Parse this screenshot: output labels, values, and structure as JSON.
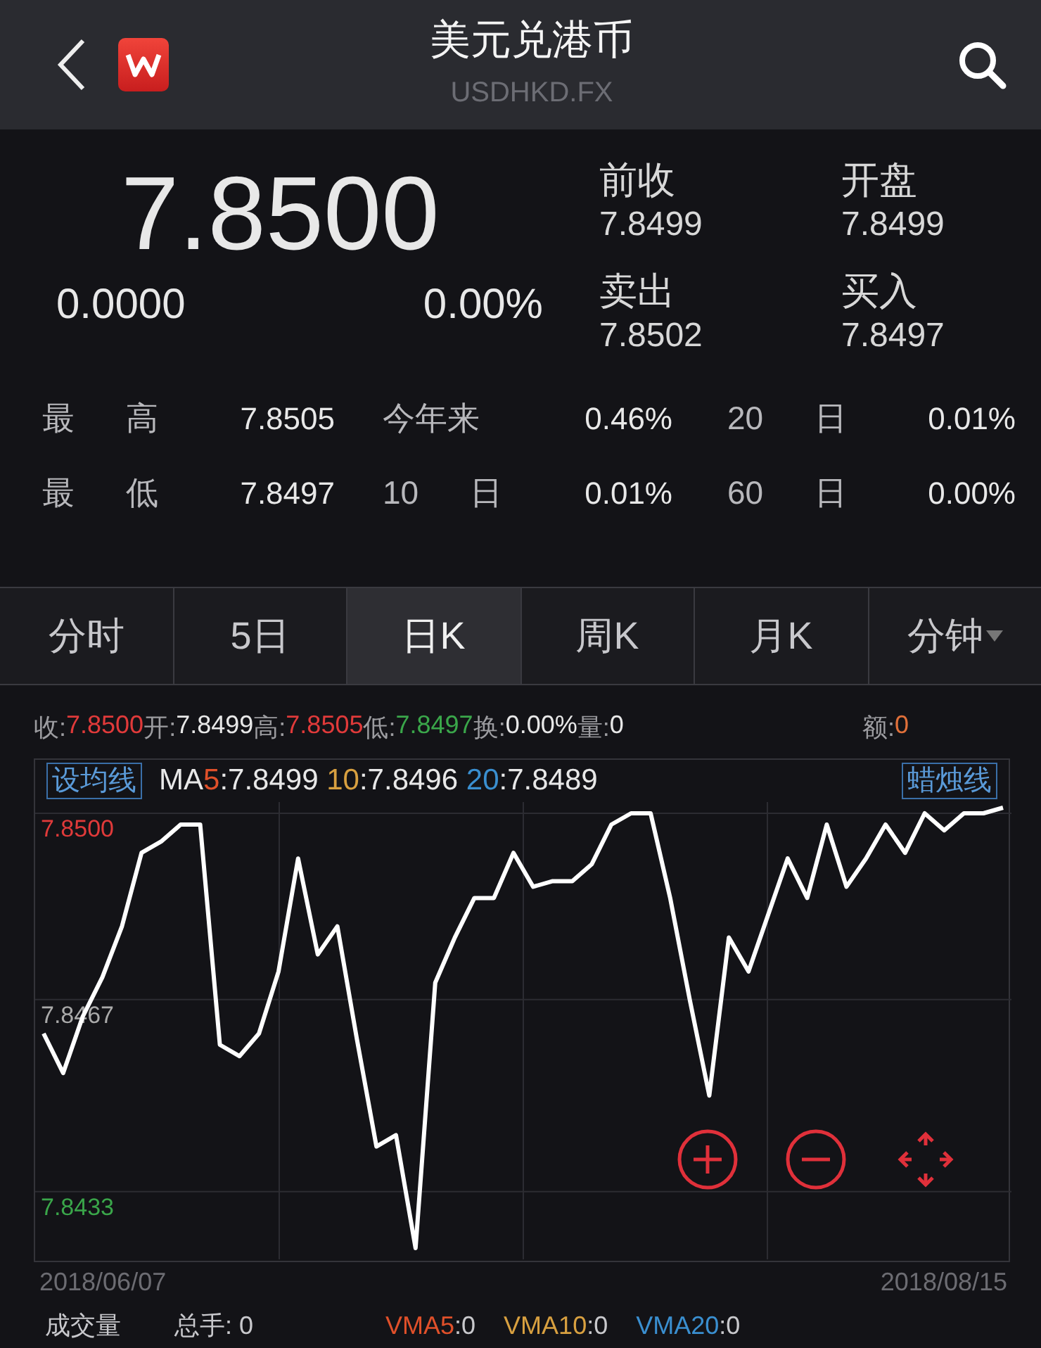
{
  "header": {
    "title": "美元兑港币",
    "subtitle": "USDHKD.FX"
  },
  "quote": {
    "price": "7.8500",
    "change": "0.0000",
    "change_pct": "0.00%",
    "fields": [
      {
        "label": "前收",
        "value": "7.8499"
      },
      {
        "label": "开盘",
        "value": "7.8499"
      },
      {
        "label": "卖出",
        "value": "7.8502"
      },
      {
        "label": "买入",
        "value": "7.8497"
      }
    ]
  },
  "stats": [
    [
      {
        "label": "最 高",
        "value": "7.8505"
      },
      {
        "label": "今年来",
        "value": "0.46%"
      },
      {
        "label": "20 日",
        "value": "0.01%"
      }
    ],
    [
      {
        "label": "最 低",
        "value": "7.8497"
      },
      {
        "label": "10 日",
        "value": "0.01%"
      },
      {
        "label": "60 日",
        "value": "0.00%"
      }
    ]
  ],
  "tabs": [
    {
      "label": "分时",
      "selected": false
    },
    {
      "label": "5日",
      "selected": false
    },
    {
      "label": "日K",
      "selected": true
    },
    {
      "label": "周K",
      "selected": false
    },
    {
      "label": "月K",
      "selected": false
    },
    {
      "label": "分钟",
      "selected": false,
      "dropdown": true
    }
  ],
  "info_line": [
    {
      "label": "收:",
      "value": "7.8500",
      "color": "#e03a3a"
    },
    {
      "label": "开:",
      "value": "7.8499",
      "color": "#e8e8e8"
    },
    {
      "label": "高:",
      "value": "7.8505",
      "color": "#e03a3a"
    },
    {
      "label": "低:",
      "value": "7.8497",
      "color": "#3aa64a"
    },
    {
      "label": "换:",
      "value": "0.00%",
      "color": "#e8e8e8"
    },
    {
      "label": "量:",
      "value": "0",
      "color": "#e8e8e8"
    },
    {
      "label": "额:",
      "value": "0",
      "color": "#e0703a"
    }
  ],
  "chart_panel": {
    "ma_button": "设均线",
    "style_button": "蜡烛线",
    "ma_prefix": "MA",
    "ma": [
      {
        "period": "5",
        "value": ":7.8499",
        "color": "#e0502a"
      },
      {
        "period": "10",
        "value": ":7.8496",
        "color": "#d8a040"
      },
      {
        "period": "20",
        "value": ":7.8489",
        "color": "#3a8fd0"
      }
    ],
    "date_range": {
      "start": "2018/06/07",
      "end": "2018/08/15"
    },
    "chart_data": {
      "type": "line",
      "grid": true,
      "series": [
        {
          "color": "#ffffff",
          "values": [
            7.8461,
            7.8454,
            7.8464,
            7.8471,
            7.848,
            7.8493,
            7.8495,
            7.8498,
            7.8498,
            7.8459,
            7.8457,
            7.8461,
            7.8472,
            7.8492,
            7.8475,
            7.848,
            7.846,
            7.8441,
            7.8443,
            7.8423,
            7.847,
            7.8478,
            7.8485,
            7.8485,
            7.8493,
            7.8487,
            7.8488,
            7.8488,
            7.8491,
            7.8498,
            7.85,
            7.85,
            7.8485,
            7.8467,
            7.845,
            7.8478,
            7.8472,
            7.8482,
            7.8492,
            7.8485,
            7.8498,
            7.8487,
            7.8492,
            7.8498,
            7.8493,
            7.85,
            7.8497,
            7.85,
            7.85,
            7.8501
          ]
        }
      ],
      "ylim": [
        7.8421,
        7.8502
      ],
      "yticks": [
        {
          "value": 7.85,
          "label": "7.8500"
        },
        {
          "value": 7.8467,
          "label": "7.8467"
        },
        {
          "value": 7.8433,
          "label": "7.8433"
        }
      ]
    }
  },
  "volume": {
    "title": "成交量",
    "total": "总手: 0",
    "vma": [
      {
        "label": "VMA5",
        "value": ":0",
        "color": "#e0502a"
      },
      {
        "label": "VMA10",
        "value": ":0",
        "color": "#d8a040"
      },
      {
        "label": "VMA20",
        "value": ":0",
        "color": "#3a8fd0"
      }
    ]
  }
}
